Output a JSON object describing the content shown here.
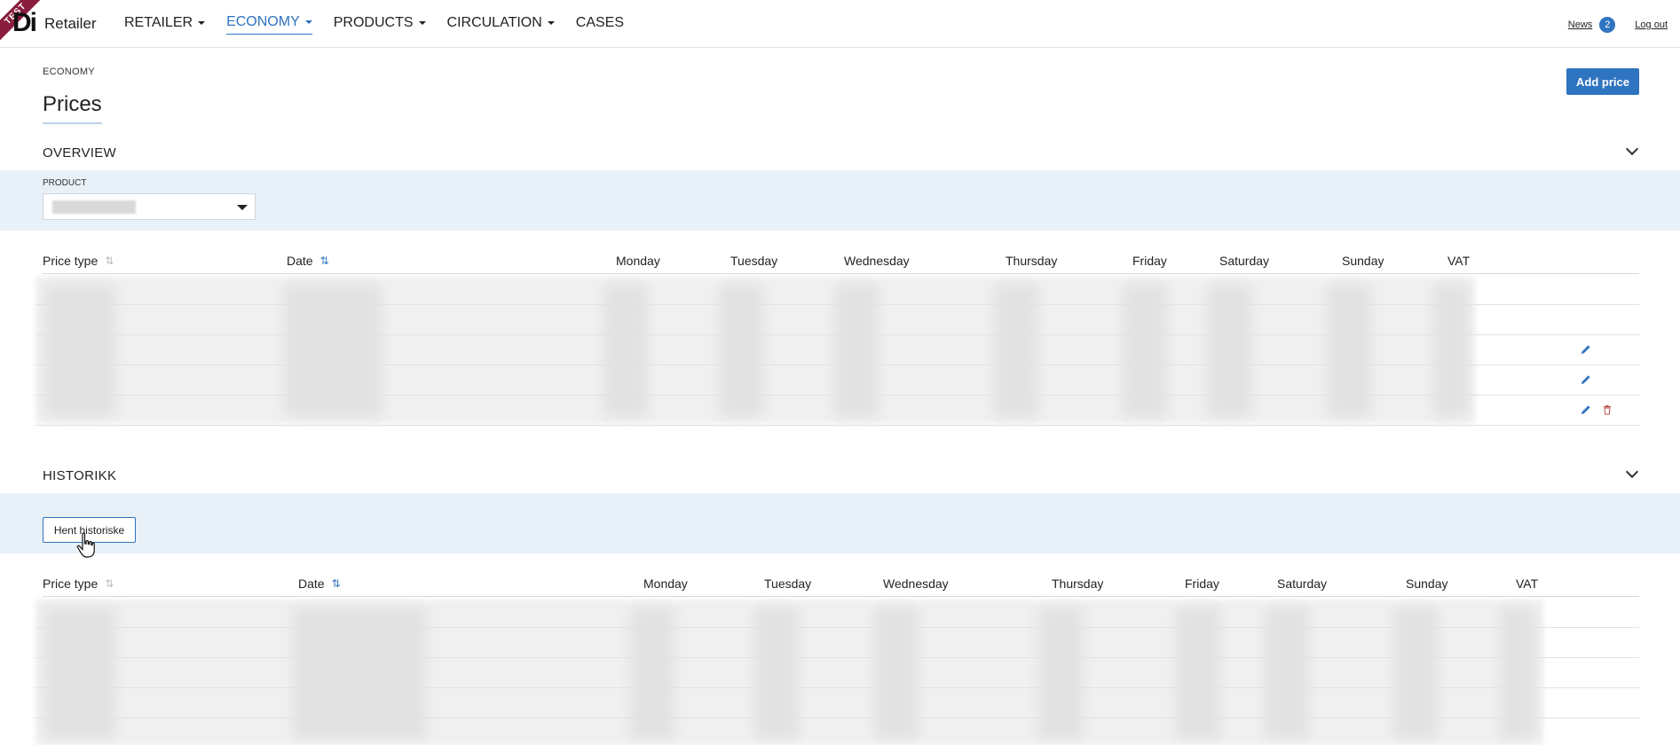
{
  "app": {
    "ribbon": "TEST",
    "logo": "Di",
    "name": "Retailer"
  },
  "nav": [
    {
      "label": "RETAILER",
      "dropdown": true,
      "active": false
    },
    {
      "label": "ECONOMY",
      "dropdown": true,
      "active": true
    },
    {
      "label": "PRODUCTS",
      "dropdown": true,
      "active": false
    },
    {
      "label": "CIRCULATION",
      "dropdown": true,
      "active": false
    },
    {
      "label": "CASES",
      "dropdown": false,
      "active": false
    }
  ],
  "topright": {
    "news_label": "News",
    "news_count": "2",
    "logout_label": "Log out"
  },
  "breadcrumb": "ECONOMY",
  "page_title": "Prices",
  "add_price_label": "Add price",
  "overview": {
    "title": "OVERVIEW",
    "product_label": "PRODUCT",
    "columns": [
      "Price type",
      "Date",
      "Monday",
      "Tuesday",
      "Wednesday",
      "Thursday",
      "Friday",
      "Saturday",
      "Sunday",
      "VAT"
    ]
  },
  "history": {
    "title": "HISTORIKK",
    "button_label": "Hent historiske",
    "columns": [
      "Price type",
      "Date",
      "Monday",
      "Tuesday",
      "Wednesday",
      "Thursday",
      "Friday",
      "Saturday",
      "Sunday",
      "VAT"
    ]
  },
  "colors": {
    "accent": "#2f74c0",
    "band": "#e8f0f8",
    "ribbon": "#8a1c3d"
  },
  "icons": {
    "edit": "pencil-icon",
    "delete": "trash-icon",
    "expand": "chevron-down-icon",
    "sort": "sort-icon"
  }
}
